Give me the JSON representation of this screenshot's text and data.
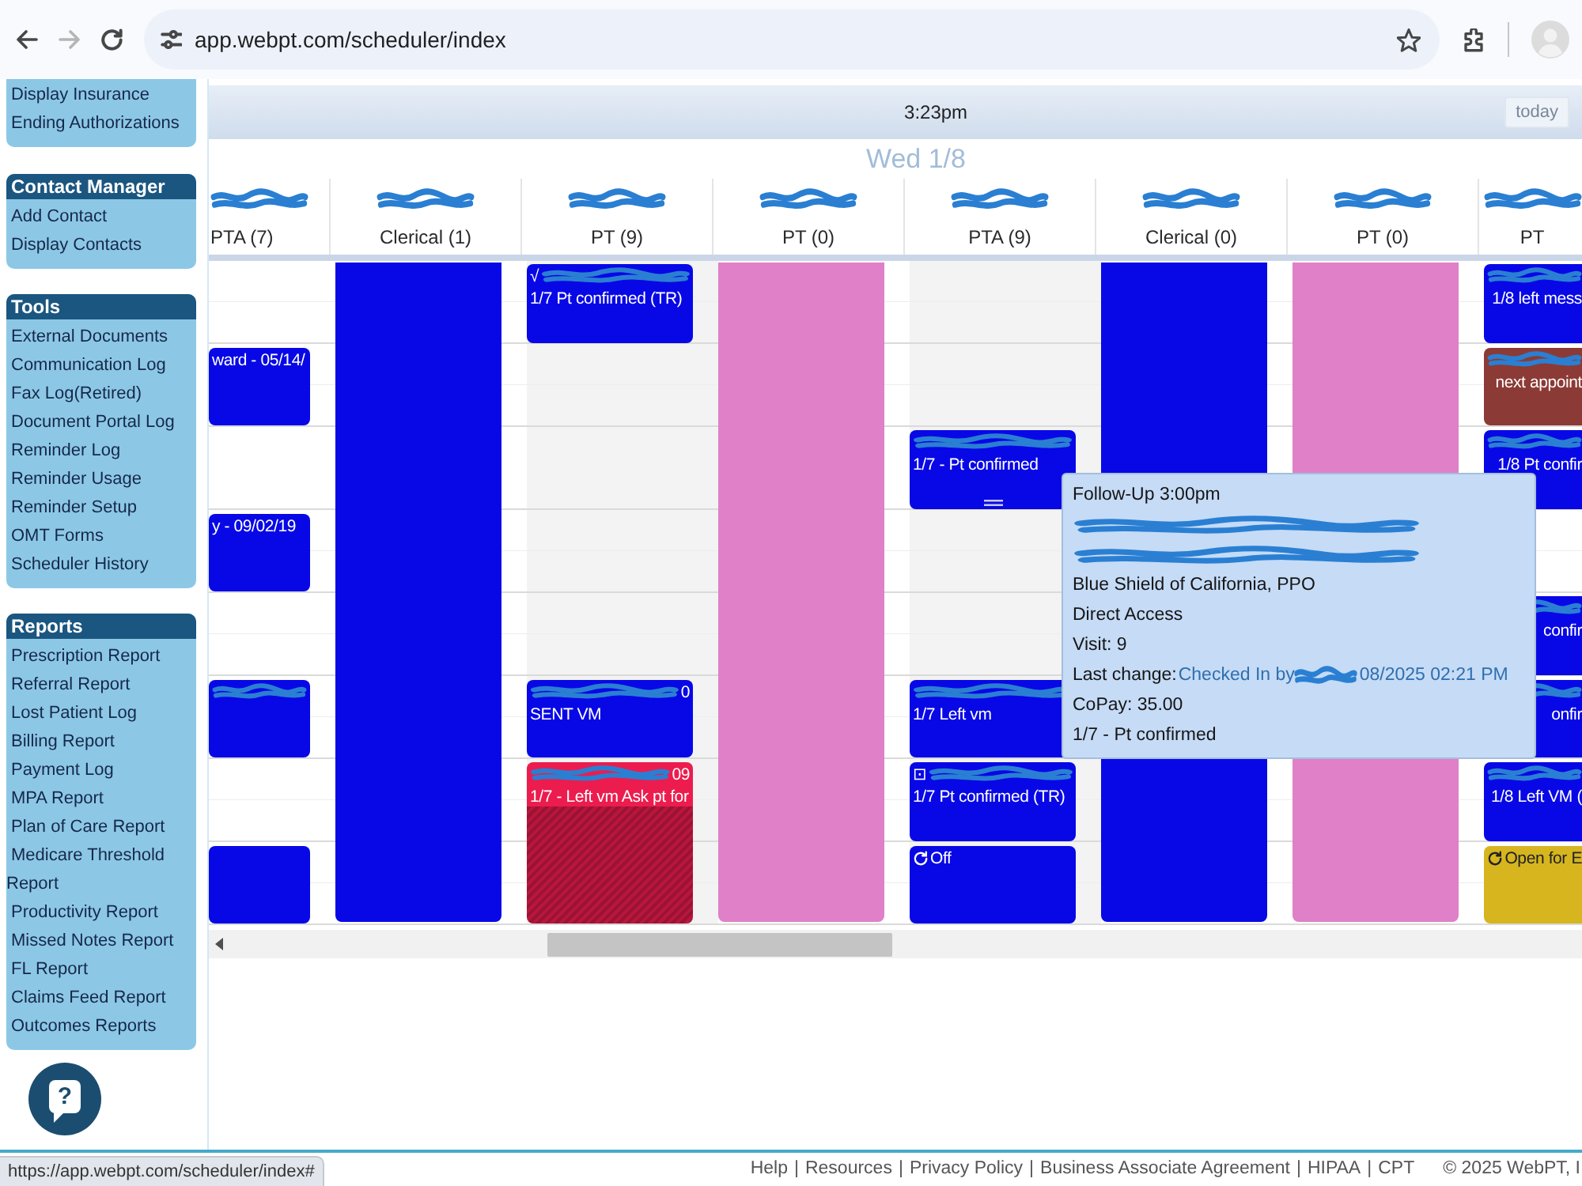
{
  "browser": {
    "url": "app.webpt.com/scheduler/index",
    "forward_enabled": false,
    "bookmarked": false
  },
  "sidebar": {
    "sections": [
      {
        "items": [
          "Display Insurance",
          "Ending Authorizations"
        ]
      },
      {
        "title": "Contact Manager",
        "items": [
          "Add Contact",
          "Display Contacts"
        ]
      },
      {
        "title": "Tools",
        "items": [
          "External Documents",
          "Communication Log",
          "Fax Log(Retired)",
          "Document Portal Log",
          "Reminder Log",
          "Reminder Usage",
          "Reminder Setup",
          "OMT Forms",
          "Scheduler History"
        ]
      },
      {
        "title": "Reports",
        "items": [
          "Prescription Report",
          "Referral Report",
          "Lost Patient Log",
          "Billing Report",
          "Payment Log",
          "MPA Report",
          "Plan of Care Report",
          "Medicare Threshold Report",
          "Productivity Report",
          "Missed Notes Report",
          "FL Report",
          "Claims Feed Report",
          "Outcomes Reports"
        ]
      }
    ]
  },
  "help_button": {
    "label": "?"
  },
  "scheduler": {
    "time": "3:23pm",
    "today_button": {
      "label": "today",
      "disabled": true
    },
    "day": "Wed 1/8",
    "columns": [
      {
        "label": "PTA (7)",
        "redacted": true,
        "shaded": false,
        "slots": [
          {
            "kind": "free"
          },
          {
            "kind": "appointment",
            "color": "#0808e6",
            "title": "ward - 05/14/",
            "redacted": false,
            "recurring": false
          },
          {
            "kind": "free"
          },
          {
            "kind": "appointment",
            "color": "#0808e6",
            "title": "y - 09/02/19",
            "redacted": false,
            "recurring": false
          },
          {
            "kind": "free"
          },
          {
            "kind": "appointment",
            "color": "#0808e6",
            "redacted": true,
            "recurring": false
          },
          {
            "kind": "free"
          },
          {
            "kind": "appointment",
            "color": "#0808e6",
            "redacted": false,
            "recurring": false
          }
        ]
      },
      {
        "label": "Clerical (1)",
        "redacted": true,
        "shaded": false,
        "slots": [
          {
            "kind": "block",
            "color": "#0808e6"
          }
        ]
      },
      {
        "label": "PT (9)",
        "redacted": true,
        "shaded": true,
        "slots": [
          {
            "kind": "appointment",
            "color": "#0808e6",
            "title": "√",
            "redacted": true,
            "recurring": false,
            "note": "1/7 Pt confirmed (TR)"
          },
          {
            "kind": "free"
          },
          {
            "kind": "free"
          },
          {
            "kind": "free"
          },
          {
            "kind": "free"
          },
          {
            "kind": "appointment",
            "color": "#0808e6",
            "redacted": true,
            "tail": "0",
            "recurring": false,
            "note": "SENT VM"
          },
          {
            "kind": "long-appointment",
            "color": "#ec1c4e",
            "redacted": true,
            "tail": "09",
            "recurring": false,
            "note": "1/7 - Left vm Ask pt for"
          }
        ]
      },
      {
        "label": "PT (0)",
        "redacted": true,
        "shaded": false,
        "slots": [
          {
            "kind": "block",
            "color": "#df80c8"
          }
        ]
      },
      {
        "label": "PTA (9)",
        "redacted": true,
        "shaded": true,
        "slots": [
          {
            "kind": "free"
          },
          {
            "kind": "free"
          },
          {
            "kind": "appointment",
            "color": "#0808e6",
            "redacted": true,
            "recurring": false,
            "note": "1/7 - Pt confirmed",
            "popover": {
              "lines": [
                {
                  "kind": "text",
                  "text": "Follow-Up 3:00pm"
                },
                {
                  "kind": "redacted"
                },
                {
                  "kind": "redacted"
                },
                {
                  "kind": "text",
                  "text": "Blue Shield of California, PPO"
                },
                {
                  "kind": "text",
                  "text": "Direct Access"
                },
                {
                  "kind": "text",
                  "text": "Visit: 9"
                },
                {
                  "kind": "change",
                  "label": "Last change:",
                  "link": "Checked In by",
                  "tail": "08/2025 02:21 PM"
                },
                {
                  "kind": "text",
                  "text": "CoPay: 35.00"
                },
                {
                  "kind": "text",
                  "text": "1/7 - Pt confirmed"
                }
              ]
            }
          },
          {
            "kind": "free"
          },
          {
            "kind": "free"
          },
          {
            "kind": "appointment",
            "color": "#0808e6",
            "redacted": true,
            "recurring": false,
            "note": "1/7 Left vm"
          },
          {
            "kind": "appointment",
            "color": "#0808e6",
            "title": "⊡",
            "redacted": true,
            "recurring": false,
            "note": "1/7 Pt confirmed (TR)"
          },
          {
            "kind": "appointment",
            "color": "#0808e6",
            "title": "Off",
            "redacted": false,
            "recurring": true
          }
        ]
      },
      {
        "label": "Clerical (0)",
        "redacted": true,
        "shaded": false,
        "slots": [
          {
            "kind": "block",
            "color": "#0808e6"
          }
        ]
      },
      {
        "label": "PT (0)",
        "redacted": true,
        "shaded": false,
        "slots": [
          {
            "kind": "block",
            "color": "#df80c8"
          }
        ]
      },
      {
        "label": "PT",
        "redacted": true,
        "shaded": false,
        "slots": [
          {
            "kind": "appointment",
            "color": "#0808e6",
            "redacted": true,
            "recurring": false,
            "note": "1/8 left mess"
          },
          {
            "kind": "appointment",
            "color": "#8c3a35",
            "redacted": true,
            "recurring": false,
            "note": "next appoint"
          },
          {
            "kind": "appointment",
            "color": "#0808e6",
            "redacted": true,
            "recurring": false,
            "note": "1/8 Pt confir"
          },
          {
            "kind": "free"
          },
          {
            "kind": "appointment",
            "color": "#0808e6",
            "redacted": true,
            "recurring": false,
            "note": "confir"
          },
          {
            "kind": "appointment",
            "color": "#0808e6",
            "redacted": true,
            "recurring": false,
            "note": "onfir"
          },
          {
            "kind": "appointment",
            "color": "#0808e6",
            "redacted": true,
            "recurring": false,
            "note": "1/8 Left VM ("
          },
          {
            "kind": "appointment",
            "color": "#d6b51f",
            "title": "Open for E",
            "redacted": false,
            "recurring": true
          }
        ]
      }
    ]
  },
  "footer": {
    "links": [
      "Help",
      "Resources",
      "Privacy Policy",
      "Business Associate Agreement",
      "HIPAA",
      "CPT"
    ],
    "separator": "|",
    "copyright": "© 2025 WebPT, I"
  },
  "status_url": "https://app.webpt.com/scheduler/index#"
}
